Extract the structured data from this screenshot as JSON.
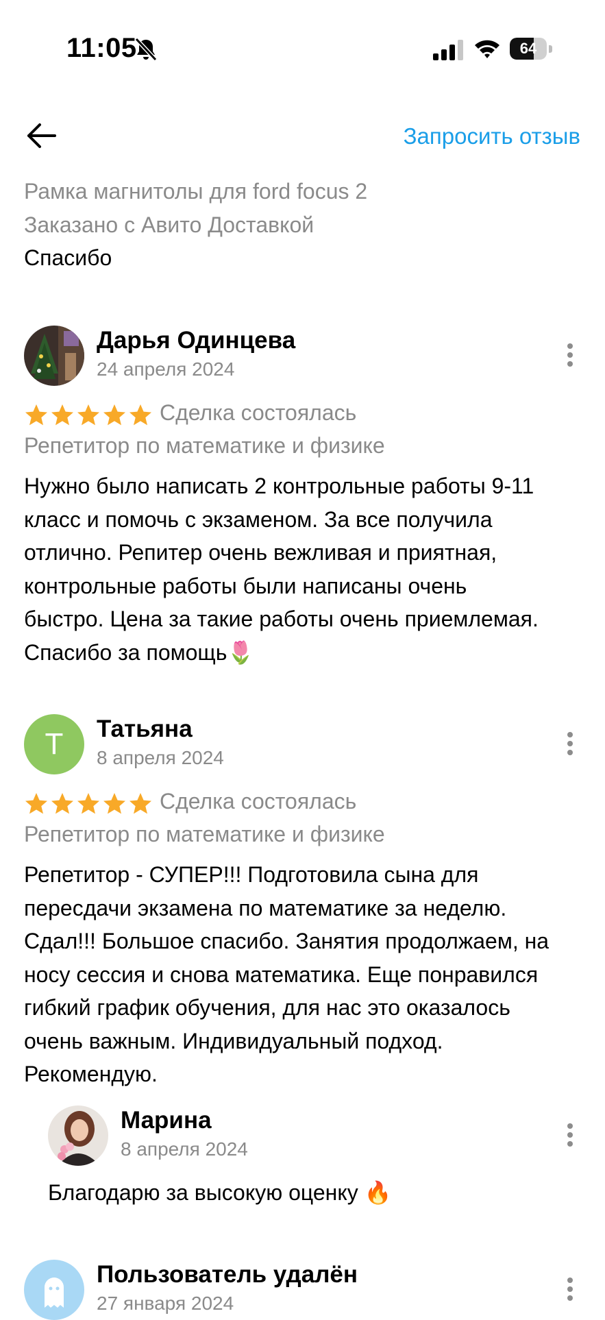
{
  "status_bar": {
    "time": "11:05",
    "battery": "64",
    "battery_level_percent": 64
  },
  "header": {
    "request_review": "Запросить отзыв"
  },
  "item": {
    "title": "Рамка магнитолы для ford focus 2",
    "delivery": "Заказано с Авито Доставкой",
    "comment": "Спасибо"
  },
  "reviews": [
    {
      "name": "Дарья Одинцева",
      "date": "24 апреля 2024",
      "rating": 5,
      "deal": "Сделка состоялась",
      "category": "Репетитор по математике и физике",
      "lines": [
        "Нужно было написать 2 контрольные работы 9-11",
        "класс и помочь с экзаменом. За все получила",
        "отлично. Репитер очень вежливая и приятная,",
        "контрольные работы были написаны очень",
        "быстро. Цена за такие работы очень приемлемая.",
        "Спасибо за помощь"
      ],
      "emoji": "🌷"
    },
    {
      "name": "Татьяна",
      "avatar_letter": "T",
      "avatar_color": "#8fc860",
      "date": "8 апреля 2024",
      "rating": 5,
      "deal": "Сделка состоялась",
      "category": "Репетитор по математике и физике",
      "lines": [
        "Репетитор - СУПЕР!!! Подготовила сына для",
        "пересдачи экзамена по математике за неделю.",
        "Сдал!!! Большое спасибо. Занятия продолжаем, на",
        "носу сессия и снова математика. Еще понравился",
        "гибкий график обучения, для нас это оказалось",
        "очень важным. Индивидуальный подход.",
        "Рекомендую."
      ],
      "reply": {
        "name": "Марина",
        "date": "8 апреля 2024",
        "text": "Благодарю за высокую оценку",
        "emoji": "🔥"
      }
    },
    {
      "name": "Пользователь удалён",
      "date": "27 января 2024",
      "avatar_color": "#a9d8f5"
    }
  ],
  "colors": {
    "accent": "#1a9ee8",
    "star": "#f8a928",
    "muted": "#8a8a8a"
  }
}
